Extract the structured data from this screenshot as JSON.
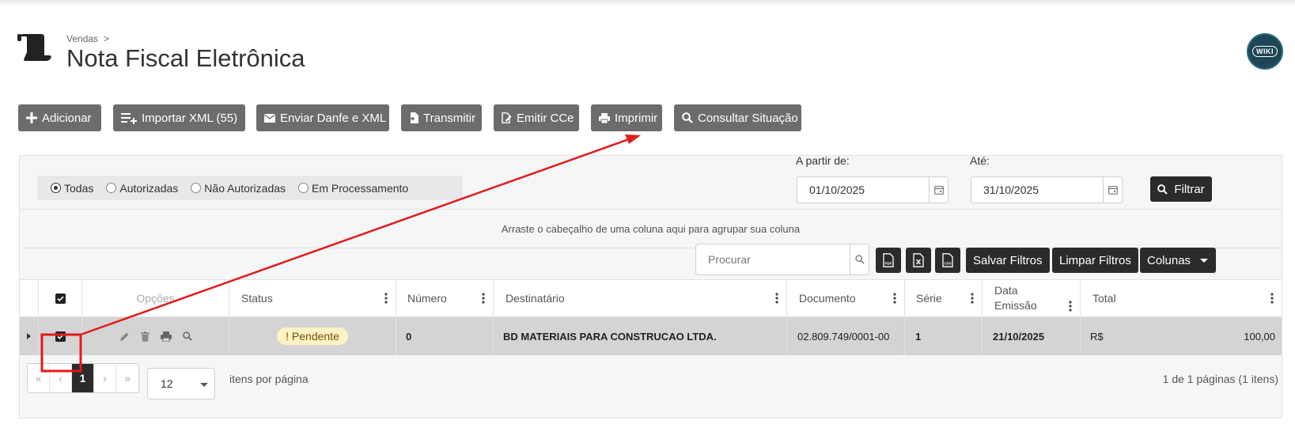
{
  "breadcrumb": {
    "parent": "Vendas",
    "separator": ">"
  },
  "page": {
    "title": "Nota Fiscal Eletrônica",
    "wiki_badge": "WIKI"
  },
  "toolbar": {
    "add": "Adicionar",
    "import_xml": "Importar XML (55)",
    "send_danfe": "Enviar Danfe e XML",
    "transmit": "Transmitir",
    "emit_cce": "Emitir CCe",
    "print": "Imprimir",
    "check_status": "Consultar Situação"
  },
  "filters": {
    "radios": [
      {
        "label": "Todas",
        "selected": true
      },
      {
        "label": "Autorizadas",
        "selected": false
      },
      {
        "label": "Não Autorizadas",
        "selected": false
      },
      {
        "label": "Em Processamento",
        "selected": false
      }
    ],
    "from_label": "A partir de:",
    "from_value": "01/10/2025",
    "to_label": "Até:",
    "to_value": "31/10/2025",
    "filter_button": "Filtrar"
  },
  "grid": {
    "group_hint": "Arraste o cabeçalho de uma coluna aqui para agrupar sua coluna",
    "search_placeholder": "Procurar",
    "export_icons": [
      "pdf-export-icon",
      "excel-export-icon",
      "csv-export-icon"
    ],
    "save_filters": "Salvar Filtros",
    "clear_filters": "Limpar Filtros",
    "columns_button": "Colunas",
    "headers": {
      "options": "Opções",
      "status": "Status",
      "number": "Número",
      "recipient": "Destinatário",
      "document": "Documento",
      "series": "Série",
      "issue_date_line1": "Data",
      "issue_date_line2": "Emissão",
      "total": "Total"
    },
    "rows": [
      {
        "status": "! Pendente",
        "number": "0",
        "recipient": "BD MATERIAIS PARA CONSTRUCAO LTDA.",
        "document": "02.809.749/0001-00",
        "series": "1",
        "issue_date": "21/10/2025",
        "currency": "R$",
        "total": "100,00"
      }
    ]
  },
  "pagination": {
    "pages": [
      "«",
      "‹",
      "1",
      "›",
      "»"
    ],
    "page_size": "12",
    "per_page_label": "itens por página",
    "info": "1 de 1 páginas (1 itens)"
  },
  "colors": {
    "toolbar_button": "#6c6c6c",
    "dark_button": "#2b2b2b",
    "selected_row": "#d4d4d4",
    "pending_badge": "#fff2c4",
    "annotation": "#e31a1a"
  }
}
